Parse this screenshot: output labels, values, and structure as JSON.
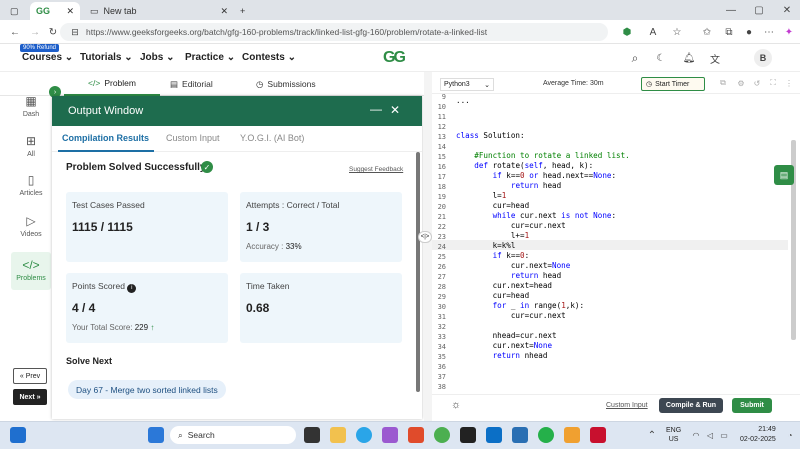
{
  "browser": {
    "tabs": [
      {
        "label": "GG"
      },
      {
        "label": "New tab"
      }
    ],
    "url": "https://www.geeksforgeeks.org/batch/gfg-160-problems/track/linked-list-gfg-160/problem/rotate-a-linked-list"
  },
  "site": {
    "refund_badge": "90% Refund",
    "nav": [
      "Courses",
      "Tutorials",
      "Jobs",
      "Practice",
      "Contests"
    ],
    "logo": "GG",
    "avatar": "B"
  },
  "problem_tabs": [
    "Problem",
    "Editorial",
    "Submissions"
  ],
  "sidebar": {
    "items": [
      "Dash",
      "All",
      "Articles",
      "Videos",
      "Problems"
    ],
    "prev": "« Prev",
    "next": "Next »"
  },
  "output_window": {
    "title": "Output Window",
    "tabs": [
      "Compilation Results",
      "Custom Input",
      "Y.O.G.I. (AI Bot)"
    ],
    "status": "Problem Solved Successfully",
    "suggest": "Suggest Feedback",
    "test_cases_label": "Test Cases Passed",
    "test_cases_value": "1115 / 1115",
    "attempts_label": "Attempts : Correct / Total",
    "attempts_value": "1 / 3",
    "accuracy_label": "Accuracy :",
    "accuracy_value": "33%",
    "points_label": "Points Scored",
    "points_value": "4 / 4",
    "total_score_label": "Your Total Score:",
    "total_score_value": "229",
    "time_label": "Time Taken",
    "time_value": "0.68",
    "solve_next": "Solve Next",
    "next_problem": "Day 67 - Merge two sorted linked lists"
  },
  "editor": {
    "language": "Python3",
    "avg_time": "Average Time: 30m",
    "timer": "Start Timer",
    "line_numbers": [
      "9",
      "10",
      "11",
      "12",
      "13",
      "14",
      "15",
      "16",
      "17",
      "18",
      "19",
      "20",
      "21",
      "22",
      "23",
      "24",
      "25",
      "26",
      "27",
      "28",
      "29",
      "30",
      "31",
      "32",
      "33",
      "34",
      "35",
      "36",
      "37",
      "38"
    ],
    "custom_input": "Custom Input",
    "compile_run": "Compile & Run",
    "submit": "Submit"
  },
  "taskbar": {
    "search": "Search",
    "lang": "ENG",
    "region": "US",
    "time": "21:49",
    "date": "02-02-2025"
  },
  "colors": {
    "brand_green": "#2f8d46",
    "header_green": "#1e6c4e",
    "card_bg": "#eef6fb",
    "submit_green": "#2f8d46"
  }
}
